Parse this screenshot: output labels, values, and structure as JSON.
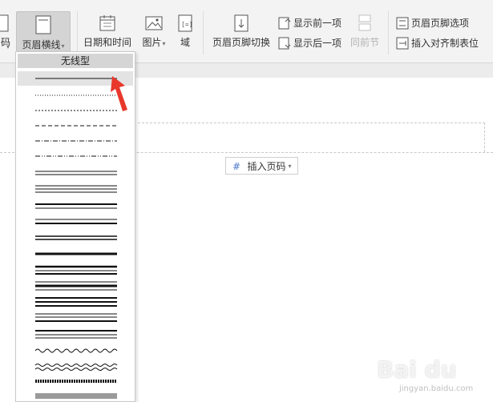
{
  "ribbon": {
    "partial_left_label": "码",
    "header_line_button": "页眉横线",
    "date_time_button": "日期和时间",
    "picture_button": "图片",
    "field_button": "域",
    "switch_header_footer_button": "页眉页脚切换",
    "show_previous_button": "显示前一项",
    "show_next_button": "显示后一项",
    "same_as_previous_button": "同前节",
    "header_footer_options_button": "页眉页脚选项",
    "insert_align_tab_button": "插入对齐制表位"
  },
  "document": {
    "insert_page_number_button": "插入页码"
  },
  "dropdown": {
    "header": "无线型",
    "items": [
      "single-thin",
      "dotted",
      "dashed-short",
      "dashed",
      "dash-dot",
      "dash-dot-dot",
      "double-thin",
      "triple-thin",
      "thick-thin",
      "thin-thick",
      "double-medium",
      "thick",
      "thick-thin-thick",
      "thin-thick-thin",
      "triple-thick",
      "thin-thin-thick",
      "thick-thin-thin",
      "wave",
      "double-wave",
      "dash-dot-stroked",
      "thick-gray"
    ]
  },
  "watermark": {
    "text": "Bai du",
    "sub": "jingyan.baidu.com"
  },
  "colors": {
    "accent_arrow": "#e8382c",
    "selected_button": "#d4d4d4"
  }
}
